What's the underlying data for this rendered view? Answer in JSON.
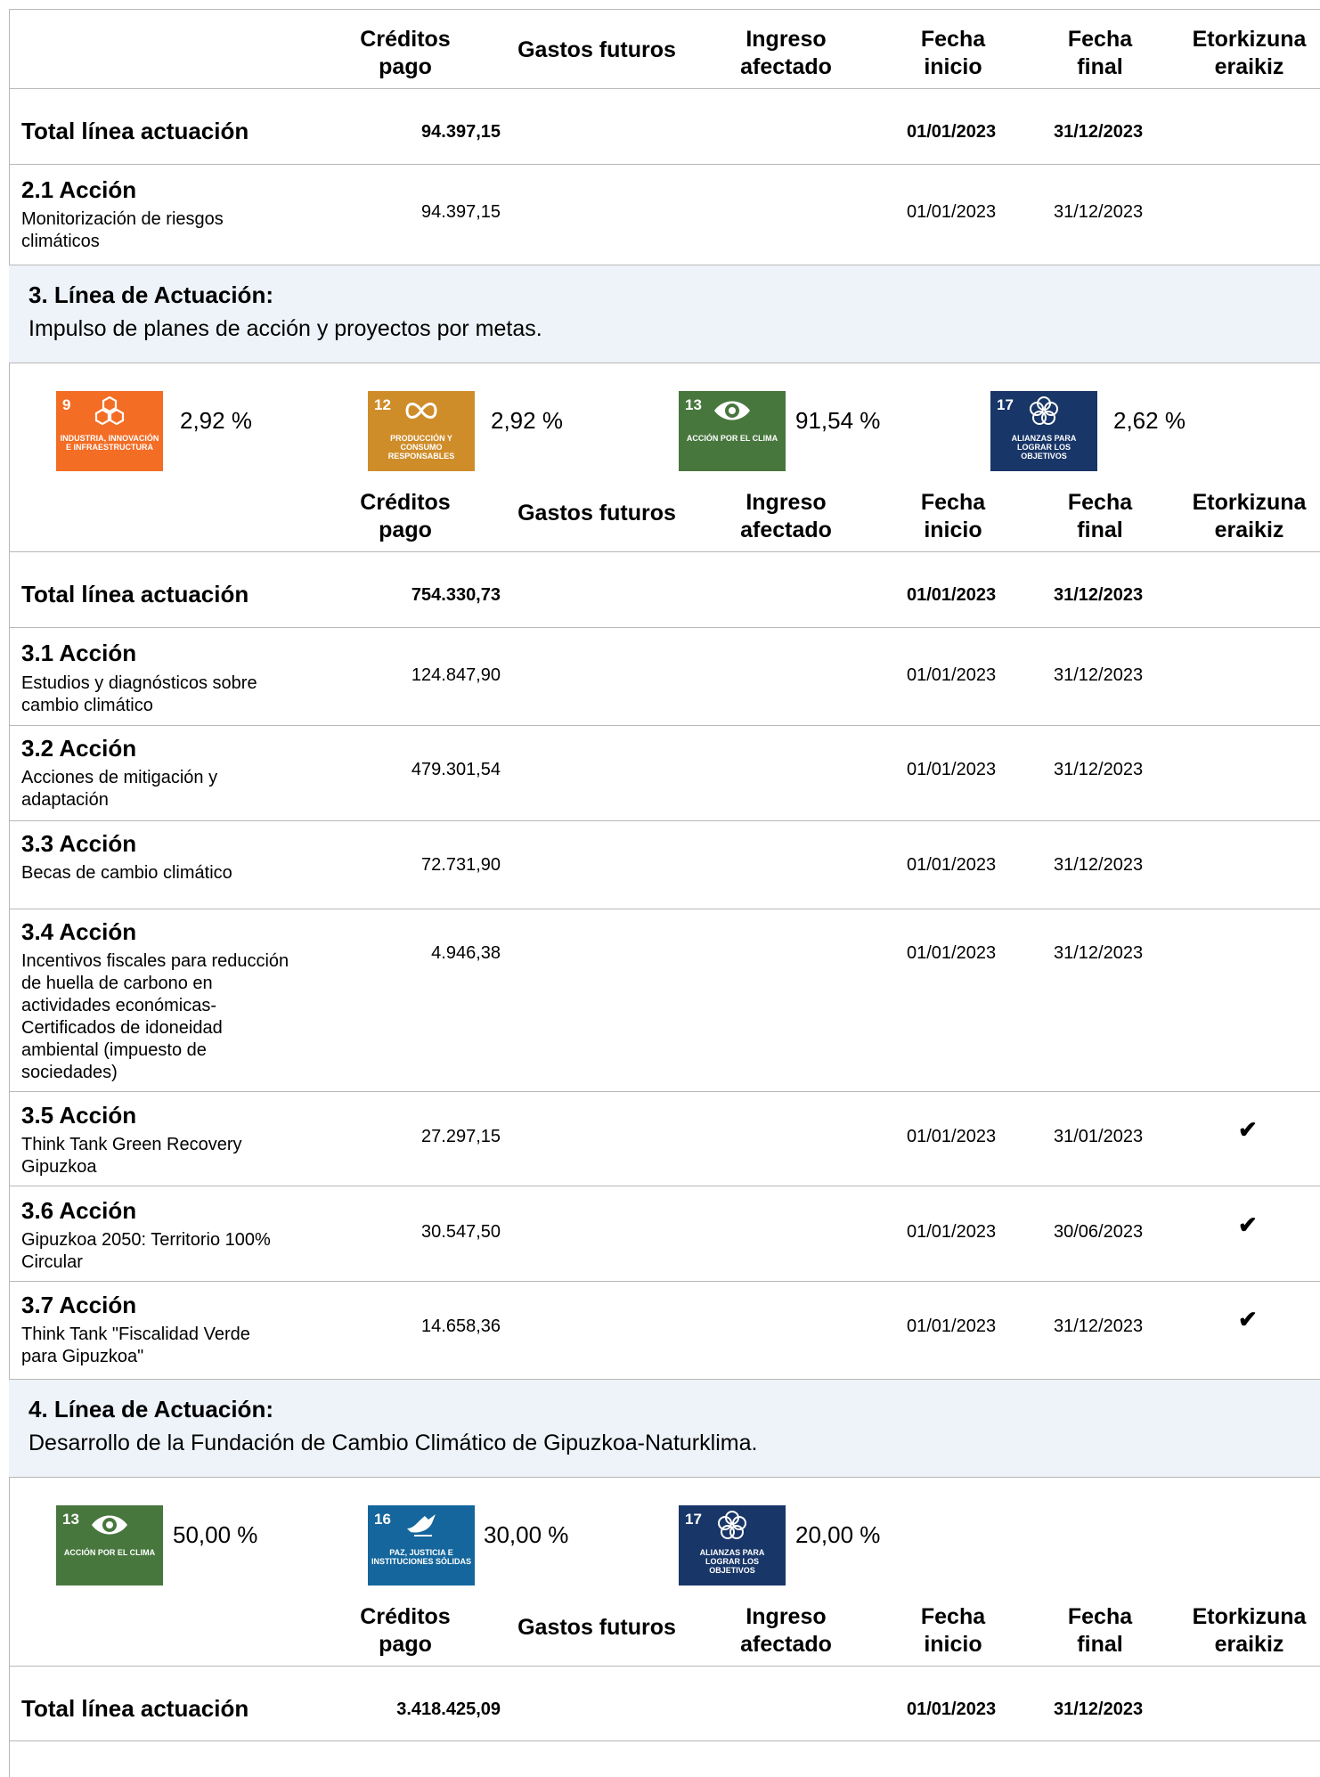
{
  "columns": {
    "creditos": "Créditos pago",
    "gastos": "Gastos futuros",
    "ingreso": "Ingreso afectado",
    "fecha_inicio": "Fecha inicio",
    "fecha_final": "Fecha final",
    "etorkizuna": "Etorkizuna eraikiz"
  },
  "section2": {
    "total": {
      "label": "Total línea actuación",
      "creditos": "94.397,15",
      "inicio": "01/01/2023",
      "final": "31/12/2023"
    },
    "actions": [
      {
        "title": "2.1 Acción",
        "desc": "Monitorización de riesgos climáticos",
        "creditos": "94.397,15",
        "inicio": "01/01/2023",
        "final": "31/12/2023"
      }
    ]
  },
  "section3": {
    "title": "3. Línea de Actuación:",
    "desc": "Impulso de planes de acción y proyectos por metas.",
    "sdgs": [
      {
        "num": "9",
        "text": "INDUSTRIA, INNOVACIÓN E INFRAESTRUCTURA",
        "pct": "2,92 %",
        "color": "#f36d25",
        "icon": "cubes-icon"
      },
      {
        "num": "12",
        "text": "PRODUCCIÓN Y CONSUMO RESPONSABLES",
        "pct": "2,92 %",
        "color": "#cf8d2a",
        "icon": "infinity-icon"
      },
      {
        "num": "13",
        "text": "ACCIÓN POR EL CLIMA",
        "pct": "91,54 %",
        "color": "#48773e",
        "icon": "eye-globe-icon"
      },
      {
        "num": "17",
        "text": "ALIANZAS PARA LOGRAR LOS OBJETIVOS",
        "pct": "2,62 %",
        "color": "#183668",
        "icon": "flower-icon"
      }
    ],
    "total": {
      "label": "Total línea actuación",
      "creditos": "754.330,73",
      "inicio": "01/01/2023",
      "final": "31/12/2023"
    },
    "actions": [
      {
        "title": "3.1 Acción",
        "desc": "Estudios y diagnósticos sobre cambio climático",
        "creditos": "124.847,90",
        "inicio": "01/01/2023",
        "final": "31/12/2023",
        "check": ""
      },
      {
        "title": "3.2 Acción",
        "desc": "Acciones de mitigación y adaptación",
        "creditos": "479.301,54",
        "inicio": "01/01/2023",
        "final": "31/12/2023",
        "check": ""
      },
      {
        "title": "3.3 Acción",
        "desc": "Becas de cambio climático",
        "creditos": "72.731,90",
        "inicio": "01/01/2023",
        "final": "31/12/2023",
        "check": ""
      },
      {
        "title": "3.4 Acción",
        "desc": "Incentivos fiscales para reducción de huella de carbono en actividades económicas-Certificados de idoneidad ambiental (impuesto de sociedades)",
        "creditos": "4.946,38",
        "inicio": "01/01/2023",
        "final": "31/12/2023",
        "check": ""
      },
      {
        "title": "3.5 Acción",
        "desc": "Think Tank Green Recovery Gipuzkoa",
        "creditos": "27.297,15",
        "inicio": "01/01/2023",
        "final": "31/01/2023",
        "check": "✔"
      },
      {
        "title": "3.6 Acción",
        "desc": "Gipuzkoa 2050: Territorio 100% Circular",
        "creditos": "30.547,50",
        "inicio": "01/01/2023",
        "final": "30/06/2023",
        "check": "✔"
      },
      {
        "title": "3.7 Acción",
        "desc": "Think Tank \"Fiscalidad Verde para Gipuzkoa\"",
        "creditos": "14.658,36",
        "inicio": "01/01/2023",
        "final": "31/12/2023",
        "check": "✔"
      }
    ]
  },
  "section4": {
    "title": "4. Línea de Actuación:",
    "desc": "Desarrollo de la Fundación de Cambio Climático de Gipuzkoa-Naturklima.",
    "sdgs": [
      {
        "num": "13",
        "text": "ACCIÓN POR EL CLIMA",
        "pct": "50,00 %",
        "color": "#48773e",
        "icon": "eye-globe-icon"
      },
      {
        "num": "16",
        "text": "PAZ, JUSTICIA E INSTITUCIONES SÓLIDAS",
        "pct": "30,00 %",
        "color": "#14669c",
        "icon": "dove-icon"
      },
      {
        "num": "17",
        "text": "ALIANZAS PARA LOGRAR LOS OBJETIVOS",
        "pct": "20,00 %",
        "color": "#183668",
        "icon": "flower-icon"
      }
    ],
    "total": {
      "label": "Total línea actuación",
      "creditos": "3.418.425,09",
      "inicio": "01/01/2023",
      "final": "31/12/2023"
    }
  }
}
